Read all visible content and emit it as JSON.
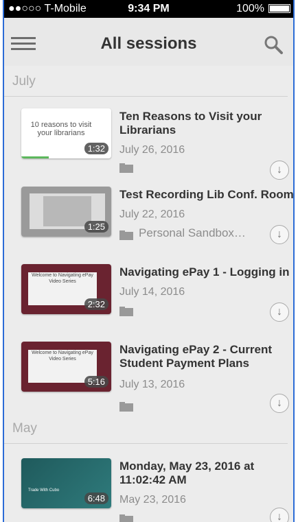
{
  "status": {
    "carrier": "●●○○○ T-Mobile",
    "time": "9:34 PM",
    "battery": "100%"
  },
  "header": {
    "title": "All sessions"
  },
  "sections": [
    {
      "label": "July"
    },
    {
      "label": "May"
    }
  ],
  "items": [
    {
      "title": "Ten Reasons to Visit your Librarians",
      "date": "July 26, 2016",
      "duration": "1:32",
      "folder": "",
      "thumb_text": "10 reasons to visit your librarians"
    },
    {
      "title": "Test Recording Lib Conf. Room",
      "date": "July 22, 2016",
      "duration": "1:25",
      "folder": "Personal Sandbox…"
    },
    {
      "title": "Navigating ePay 1 - Logging in",
      "date": "July 14, 2016",
      "duration": "2:32",
      "folder": "",
      "thumb_text": "Welcome to Navigating ePay Video Series"
    },
    {
      "title": "Navigating ePay 2 - Current Student Payment Plans",
      "date": "July 13, 2016",
      "duration": "5:16",
      "folder": "",
      "thumb_text": "Welcome to Navigating ePay Video Series"
    },
    {
      "title": "Monday, May 23, 2016 at 11:02:42 AM",
      "date": "May 23, 2016",
      "duration": "6:48",
      "folder": "",
      "thumb_text": "Trade With Cubo"
    }
  ]
}
